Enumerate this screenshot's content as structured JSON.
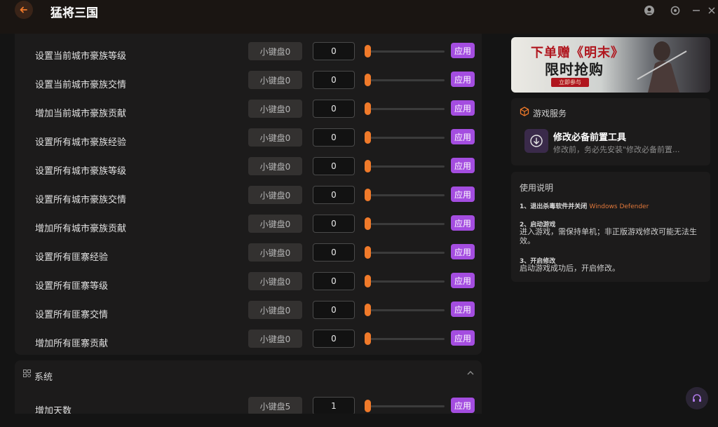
{
  "app": {
    "title": "猛将三国"
  },
  "cheats": [
    {
      "label": "设置当前城市豪族等级",
      "hotkey": "小键盘0",
      "value": "0",
      "apply": "应用"
    },
    {
      "label": "设置当前城市豪族交情",
      "hotkey": "小键盘0",
      "value": "0",
      "apply": "应用"
    },
    {
      "label": "增加当前城市豪族贡献",
      "hotkey": "小键盘0",
      "value": "0",
      "apply": "应用"
    },
    {
      "label": "设置所有城市豪族经验",
      "hotkey": "小键盘0",
      "value": "0",
      "apply": "应用"
    },
    {
      "label": "设置所有城市豪族等级",
      "hotkey": "小键盘0",
      "value": "0",
      "apply": "应用"
    },
    {
      "label": "设置所有城市豪族交情",
      "hotkey": "小键盘0",
      "value": "0",
      "apply": "应用"
    },
    {
      "label": "增加所有城市豪族贡献",
      "hotkey": "小键盘0",
      "value": "0",
      "apply": "应用"
    },
    {
      "label": "设置所有匪寨经验",
      "hotkey": "小键盘0",
      "value": "0",
      "apply": "应用"
    },
    {
      "label": "设置所有匪寨等级",
      "hotkey": "小键盘0",
      "value": "0",
      "apply": "应用"
    },
    {
      "label": "设置所有匪寨交情",
      "hotkey": "小键盘0",
      "value": "0",
      "apply": "应用"
    },
    {
      "label": "增加所有匪寨贡献",
      "hotkey": "小键盘0",
      "value": "0",
      "apply": "应用"
    }
  ],
  "system_section": {
    "title": "系统",
    "rows": [
      {
        "label": "增加天数",
        "hotkey": "小键盘5",
        "value": "1",
        "apply": "应用"
      }
    ]
  },
  "banner": {
    "line1": "下单赠《明末》",
    "line2": "限时抢购",
    "cta": "立即参与"
  },
  "game_service": {
    "title": "游戏服务",
    "tool_title": "修改必备前置工具",
    "tool_desc": "修改前，务必先安装\"修改必备前置..."
  },
  "instructions": {
    "title": "使用说明",
    "step1_head": "1、退出杀毒软件并关闭",
    "step1_accent": "Windows Defender",
    "step2_head": "2、启动游戏",
    "step2_body": "进入游戏，需保持单机；非正版游戏修改可能无法生效。",
    "step3_head": "3、开启修改",
    "step3_body": "启动游戏成功后，开启修改。"
  },
  "colors": {
    "accent_orange": "#f07a2a",
    "apply_purple": "#a44de0",
    "panel_bg": "#1c1b1b"
  }
}
